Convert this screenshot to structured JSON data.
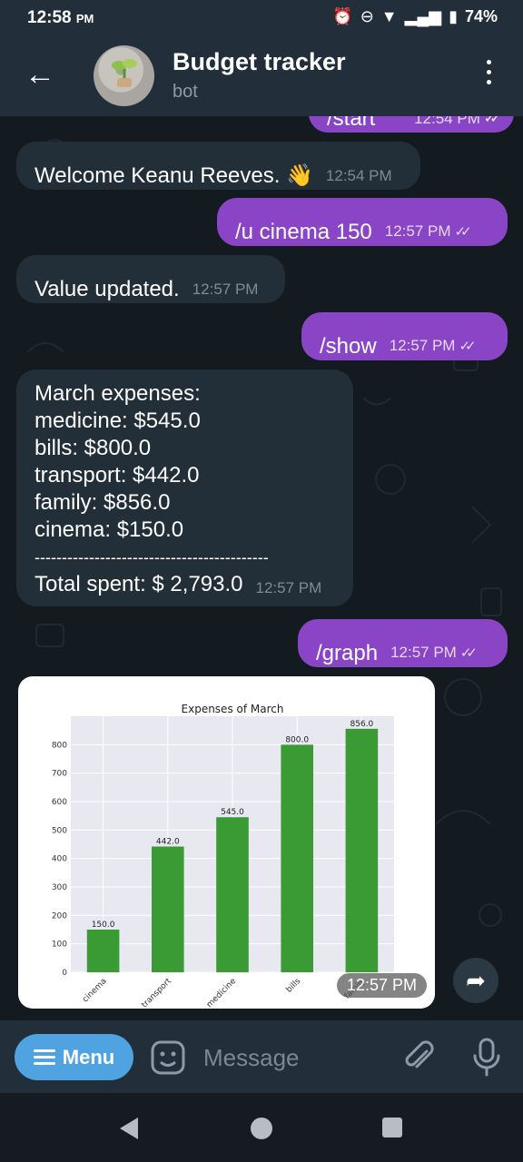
{
  "status": {
    "time": "12:58",
    "ampm": "PM",
    "battery": "74%"
  },
  "header": {
    "title": "Budget tracker",
    "subtitle": "bot"
  },
  "messages": [
    {
      "dir": "out",
      "text": "/start",
      "time": "12:54 PM",
      "partial": true
    },
    {
      "dir": "in",
      "text": "Welcome Keanu Reeves. 👋",
      "time": "12:54 PM"
    },
    {
      "dir": "out",
      "text": "/u cinema 150",
      "time": "12:57 PM"
    },
    {
      "dir": "in",
      "text": "Value updated.",
      "time": "12:57 PM"
    },
    {
      "dir": "out",
      "text": "/show",
      "time": "12:57 PM"
    },
    {
      "dir": "in",
      "lines": [
        "March expenses:",
        "medicine: $545.0",
        "bills: $800.0",
        "transport: $442.0",
        "family: $856.0",
        "cinema: $150.0",
        "-------------------------------------------",
        "Total spent: $ 2,793.0"
      ],
      "time": "12:57 PM"
    },
    {
      "dir": "out",
      "text": "/graph",
      "time": "12:57 PM"
    }
  ],
  "photo": {
    "time": "12:57 PM"
  },
  "chart_data": {
    "type": "bar",
    "title": "Expenses of March",
    "categories": [
      "cinema",
      "transport",
      "medicine",
      "bills",
      "family"
    ],
    "values": [
      150.0,
      442.0,
      545.0,
      800.0,
      856.0
    ],
    "value_labels": [
      "150.0",
      "442.0",
      "545.0",
      "800.0",
      "856.0"
    ],
    "yticks": [
      "0",
      "100",
      "200",
      "300",
      "400",
      "500",
      "600",
      "700",
      "800"
    ],
    "ylim": [
      0,
      900
    ],
    "grid": true,
    "bar_color": "#3a9b35",
    "background": "#e8e8f0",
    "xlabel": "",
    "ylabel": ""
  },
  "input": {
    "menu_label": "Menu",
    "placeholder": "Message"
  },
  "colors": {
    "outgoing": "#8a45c7",
    "incoming": "#222e38",
    "menu": "#4fa3e0"
  }
}
